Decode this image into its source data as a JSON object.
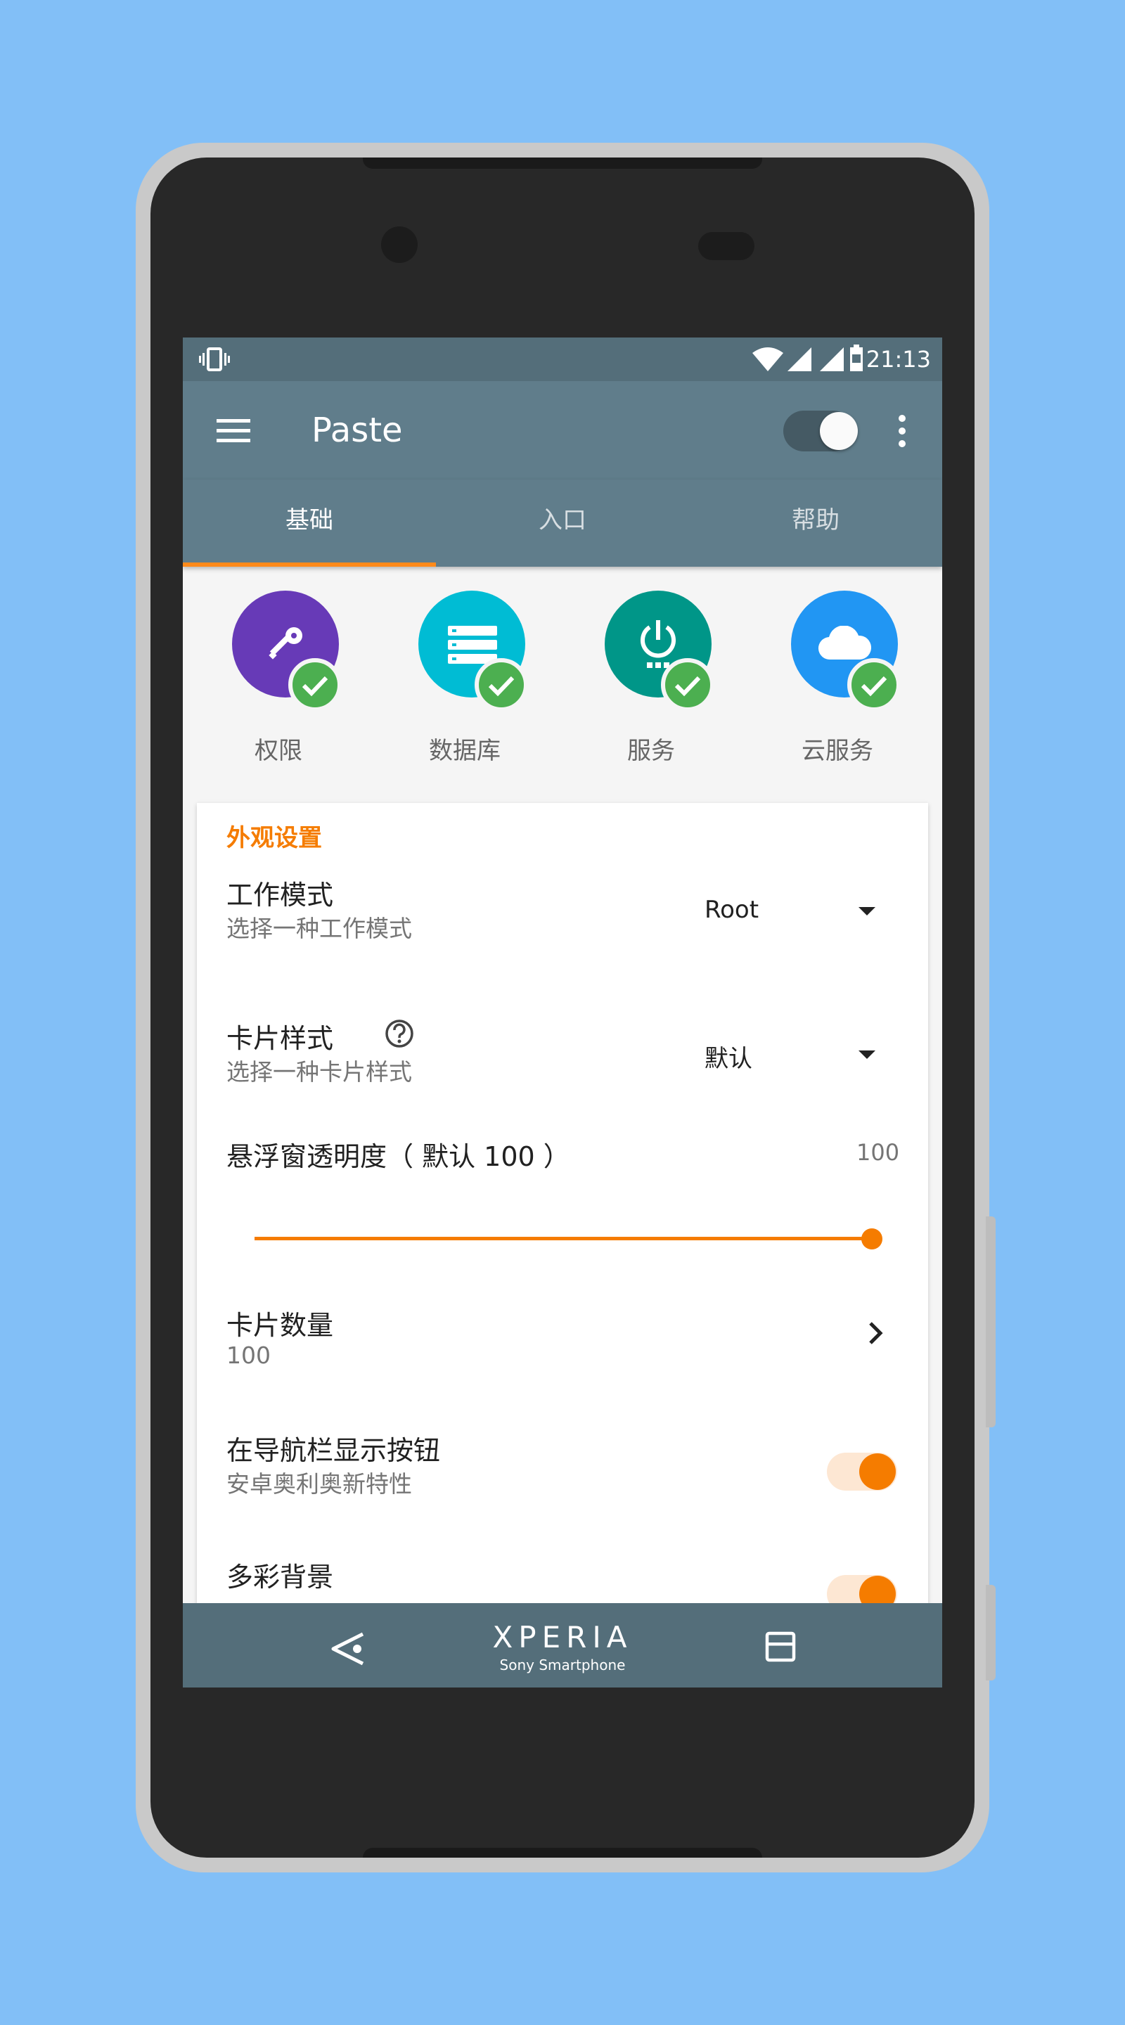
{
  "status_bar": {
    "time": "21:13",
    "icons": [
      "vibrate-icon",
      "wifi-icon",
      "signal-icon",
      "signal-icon",
      "battery-icon"
    ]
  },
  "app_bar": {
    "title": "Paste",
    "menu_icon": "menu-icon",
    "overflow_icon": "more-vert-icon",
    "master_switch_on": true
  },
  "tabs": [
    {
      "label": "基础",
      "active": true
    },
    {
      "label": "入口",
      "active": false
    },
    {
      "label": "帮助",
      "active": false
    }
  ],
  "status_items": [
    {
      "label": "权限",
      "icon": "key-icon",
      "color": "#673ab7",
      "ok": true
    },
    {
      "label": "数据库",
      "icon": "database-icon",
      "color": "#00bcd4",
      "ok": true
    },
    {
      "label": "服务",
      "icon": "power-icon",
      "color": "#009688",
      "ok": true
    },
    {
      "label": "云服务",
      "icon": "cloud-icon",
      "color": "#2196f3",
      "ok": true
    }
  ],
  "settings": {
    "section_title": "外观设置",
    "work_mode": {
      "title": "工作模式",
      "summary": "选择一种工作模式",
      "value": "Root"
    },
    "card_style": {
      "title": "卡片样式",
      "summary": "选择一种卡片样式",
      "value": "默认"
    },
    "opacity": {
      "title": "悬浮窗透明度（ 默认 100 ）",
      "value": "100",
      "level": 100
    },
    "card_count": {
      "title": "卡片数量",
      "summary": "100"
    },
    "nav_button": {
      "title": "在导航栏显示按钮",
      "summary": "安卓奥利奥新特性",
      "enabled": true
    },
    "colorful_bg": {
      "title": "多彩背景",
      "enabled": true
    }
  },
  "nav_bar": {
    "brand": "XPERIA",
    "sub": "Sony Smartphone"
  },
  "colors": {
    "accent": "#f57c00",
    "primary": "#607d8b",
    "primary_dark": "#546e7a"
  }
}
